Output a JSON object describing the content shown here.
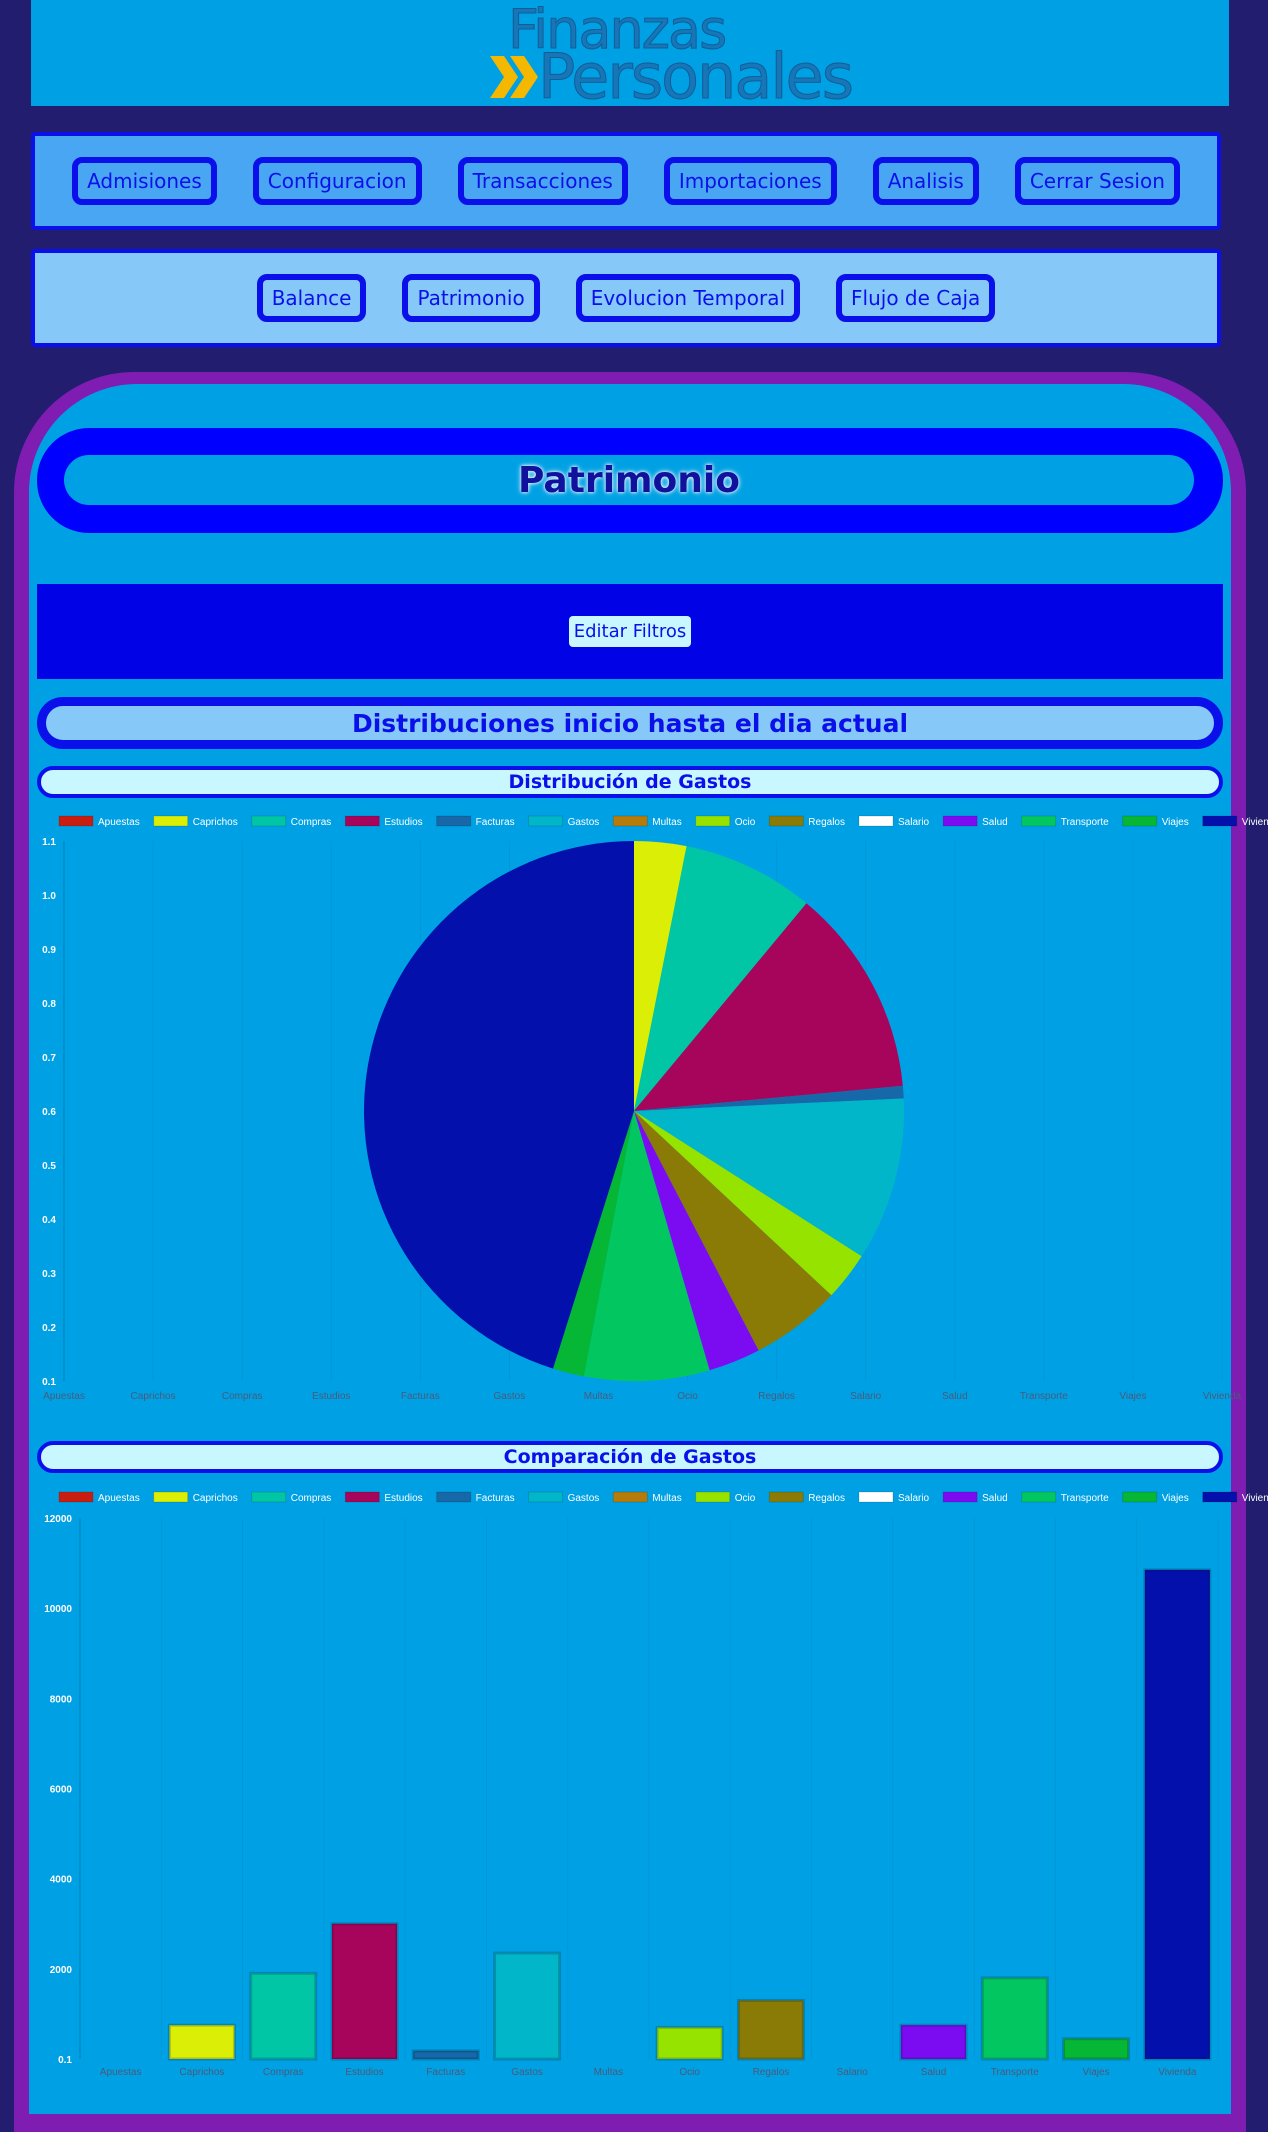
{
  "header": {
    "logo_line1": "Finanzas",
    "logo_line2": "Personales",
    "colors": {
      "logo_text": "#1676b8",
      "logo_chevron": "#f5b800"
    }
  },
  "main_nav": [
    {
      "label": "Admisiones"
    },
    {
      "label": "Configuracion"
    },
    {
      "label": "Transacciones"
    },
    {
      "label": "Importaciones"
    },
    {
      "label": "Analisis"
    },
    {
      "label": "Cerrar Sesion"
    }
  ],
  "sub_nav": [
    {
      "label": "Balance"
    },
    {
      "label": "Patrimonio"
    },
    {
      "label": "Evolucion Temporal"
    },
    {
      "label": "Flujo de Caja"
    }
  ],
  "page": {
    "title": "Patrimonio",
    "filter_button": "Editar Filtros",
    "section_title": "Distribuciones inicio hasta el dia actual"
  },
  "chart_data": [
    {
      "type": "pie",
      "title": "Distribución de Gastos",
      "legend_position": "top",
      "categories": [
        "Apuestas",
        "Caprichos",
        "Compras",
        "Estudios",
        "Facturas",
        "Gastos",
        "Multas",
        "Ocio",
        "Regalos",
        "Salario",
        "Salud",
        "Transporte",
        "Viajes",
        "Vivienda"
      ],
      "colors": [
        "#c81e12",
        "#dbee05",
        "#00c6a6",
        "#a7055b",
        "#1768a9",
        "#02b6c9",
        "#b57c0c",
        "#97e300",
        "#8a7a06",
        "#ffffff",
        "#7b0cf2",
        "#02c761",
        "#06b635",
        "#0310ab"
      ],
      "values": [
        0,
        750,
        1900,
        3000,
        180,
        2350,
        0,
        700,
        1300,
        0,
        750,
        1800,
        450,
        10850
      ],
      "axis_ticks": [
        "1.1",
        "1.0",
        "0.9",
        "0.8",
        "0.7",
        "0.6",
        "0.5",
        "0.4",
        "0.3",
        "0.2",
        "0.1"
      ]
    },
    {
      "type": "bar",
      "title": "Comparación de Gastos",
      "legend_position": "top",
      "categories": [
        "Apuestas",
        "Caprichos",
        "Compras",
        "Estudios",
        "Facturas",
        "Gastos",
        "Multas",
        "Ocio",
        "Regalos",
        "Salario",
        "Salud",
        "Transporte",
        "Viajes",
        "Vivienda"
      ],
      "colors": [
        "#c81e12",
        "#dbee05",
        "#00c6a6",
        "#a7055b",
        "#1768a9",
        "#02b6c9",
        "#b57c0c",
        "#97e300",
        "#8a7a06",
        "#ffffff",
        "#7b0cf2",
        "#02c761",
        "#06b635",
        "#0310ab"
      ],
      "values": [
        0,
        750,
        1900,
        3000,
        180,
        2350,
        0,
        700,
        1300,
        0,
        750,
        1800,
        450,
        10850
      ],
      "ylim": [
        0.1,
        12000
      ],
      "yticks": [
        {
          "v": 0.1,
          "label": "0.1"
        },
        {
          "v": 2000,
          "label": "2000"
        },
        {
          "v": 4000,
          "label": "4000"
        },
        {
          "v": 6000,
          "label": "6000"
        },
        {
          "v": 8000,
          "label": "8000"
        },
        {
          "v": 10000,
          "label": "10000"
        },
        {
          "v": 12000,
          "label": "12000"
        }
      ]
    }
  ]
}
